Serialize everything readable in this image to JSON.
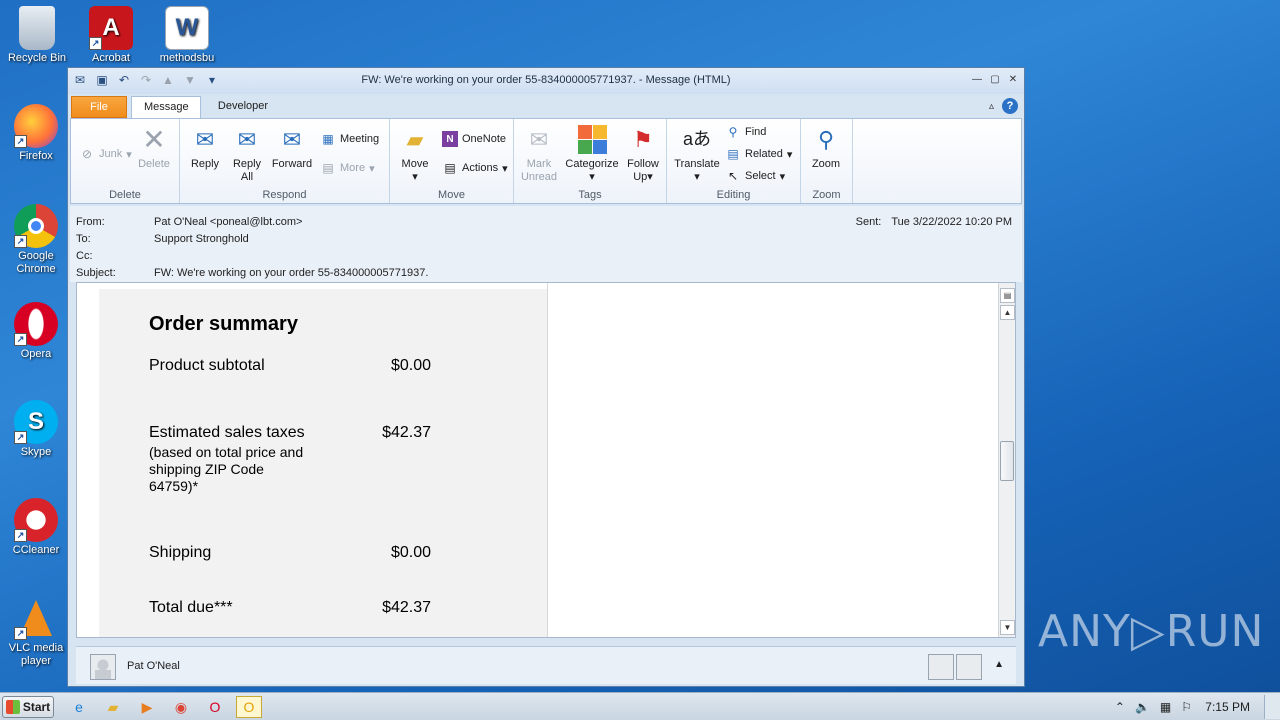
{
  "desktop": {
    "icons": [
      {
        "label": "Recycle Bin",
        "icon": "recycle-bin-icon"
      },
      {
        "label": "Acrobat",
        "icon": "acrobat-icon"
      },
      {
        "label": "methodsbu",
        "icon": "word-document-icon"
      },
      {
        "label": "Firefox",
        "icon": "firefox-icon"
      },
      {
        "label": "Google Chrome",
        "icon": "chrome-icon"
      },
      {
        "label": "Opera",
        "icon": "opera-icon"
      },
      {
        "label": "Skype",
        "icon": "skype-icon"
      },
      {
        "label": "CCleaner",
        "icon": "ccleaner-icon"
      },
      {
        "label": "VLC media player",
        "icon": "vlc-icon"
      }
    ],
    "watermark": "ANY▷RUN"
  },
  "window": {
    "title": "FW: We're working on your order 55-834000005771937. - Message (HTML)",
    "tabs": {
      "file": "File",
      "message": "Message",
      "developer": "Developer"
    }
  },
  "ribbon": {
    "delete": {
      "group": "Delete",
      "junk": "Junk",
      "delete": "Delete"
    },
    "respond": {
      "group": "Respond",
      "reply": "Reply",
      "reply_all_1": "Reply",
      "reply_all_2": "All",
      "forward": "Forward",
      "meeting": "Meeting",
      "more": "More"
    },
    "move": {
      "group": "Move",
      "move": "Move",
      "onenote": "OneNote",
      "actions": "Actions"
    },
    "tags": {
      "group": "Tags",
      "mark_unread_1": "Mark",
      "mark_unread_2": "Unread",
      "categorize": "Categorize",
      "follow_up_1": "Follow",
      "follow_up_2": "Up"
    },
    "editing": {
      "group": "Editing",
      "translate": "Translate",
      "find": "Find",
      "related": "Related",
      "select": "Select"
    },
    "zoom": {
      "group": "Zoom",
      "zoom": "Zoom"
    }
  },
  "message": {
    "from_label": "From:",
    "from": "Pat O'Neal <poneal@lbt.com>",
    "to_label": "To:",
    "to": "Support Stronghold",
    "cc_label": "Cc:",
    "cc": "",
    "subject_label": "Subject:",
    "subject": "FW: We're working on your order 55-834000005771937.",
    "sent_label": "Sent:",
    "sent": "Tue 3/22/2022 10:20 PM"
  },
  "order_summary": {
    "heading": "Order summary",
    "lines": [
      {
        "label": "Product subtotal",
        "sub": "",
        "value": "$0.00"
      },
      {
        "label": "Estimated sales taxes",
        "sub": "(based on total price and shipping ZIP Code 64759)*",
        "value": "$42.37"
      },
      {
        "label": "Shipping",
        "sub": "",
        "value": "$0.00"
      },
      {
        "label": "Total due***",
        "sub": "",
        "value": "$42.37"
      }
    ]
  },
  "people_pane": {
    "name": "Pat O'Neal"
  },
  "taskbar": {
    "start": "Start",
    "clock": "7:15 PM"
  }
}
